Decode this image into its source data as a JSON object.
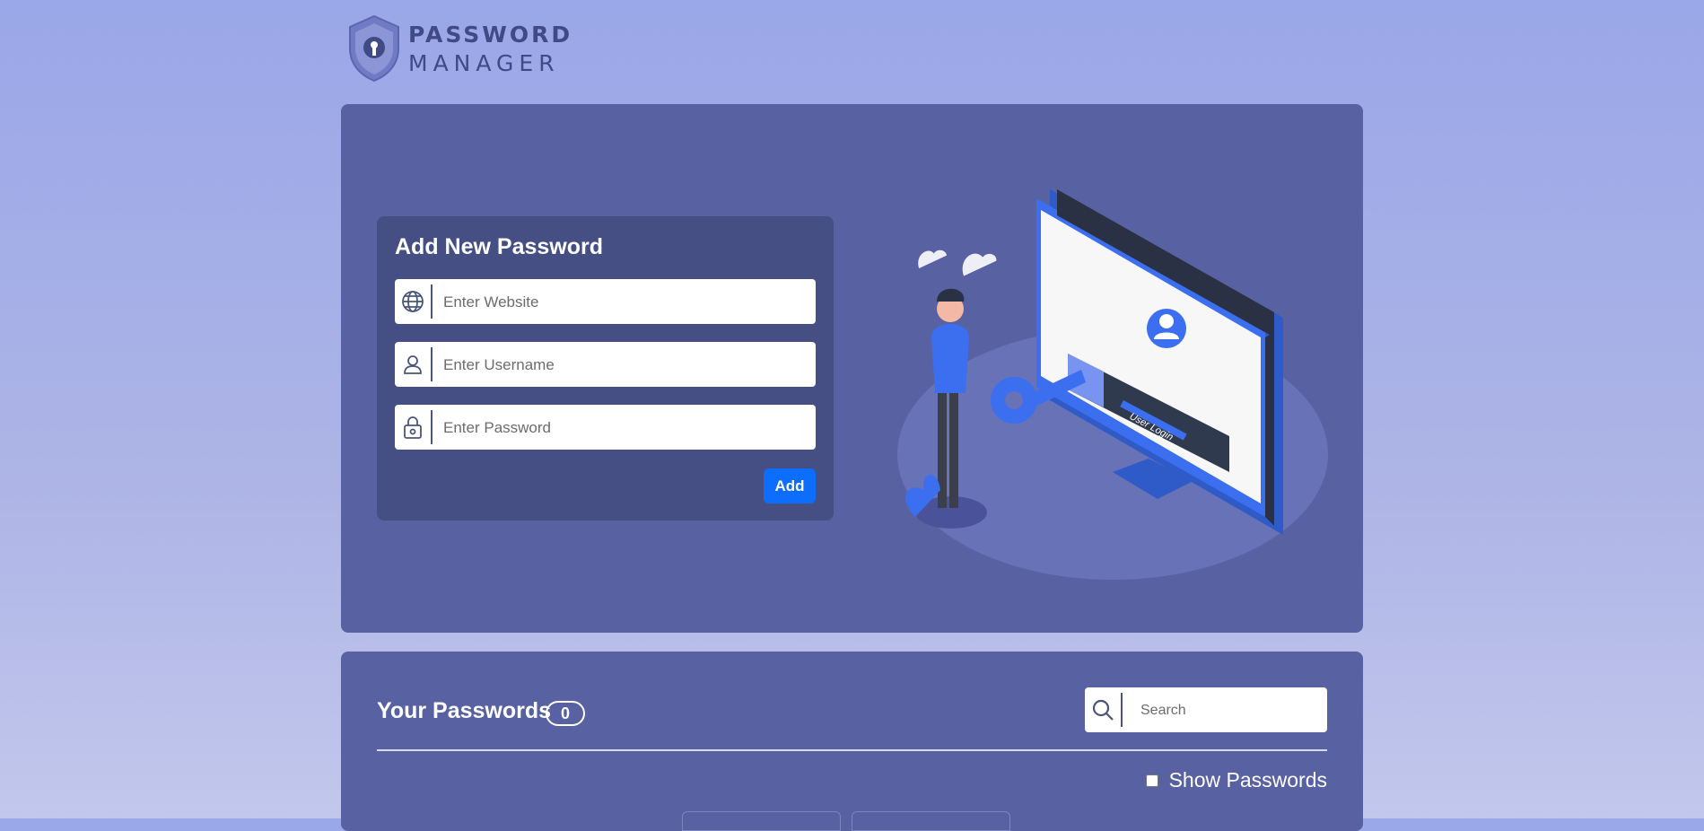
{
  "logo": {
    "line1": "PASSWORD",
    "line2": "MANAGER",
    "icon": "shield-lock-icon"
  },
  "form": {
    "title": "Add New Password",
    "website_placeholder": "Enter Website",
    "username_placeholder": "Enter Username",
    "password_placeholder": "Enter Password",
    "add_label": "Add",
    "icons": [
      "globe-icon",
      "user-icon",
      "lock-icon"
    ]
  },
  "illustration": {
    "screen_label": "User Login"
  },
  "passwords": {
    "title": "Your Passwords",
    "count": "0",
    "search_placeholder": "Search",
    "show_label": "Show Passwords"
  },
  "colors": {
    "accent": "#0d6efd",
    "card": "#5862a3",
    "form_bg": "#454f84"
  }
}
